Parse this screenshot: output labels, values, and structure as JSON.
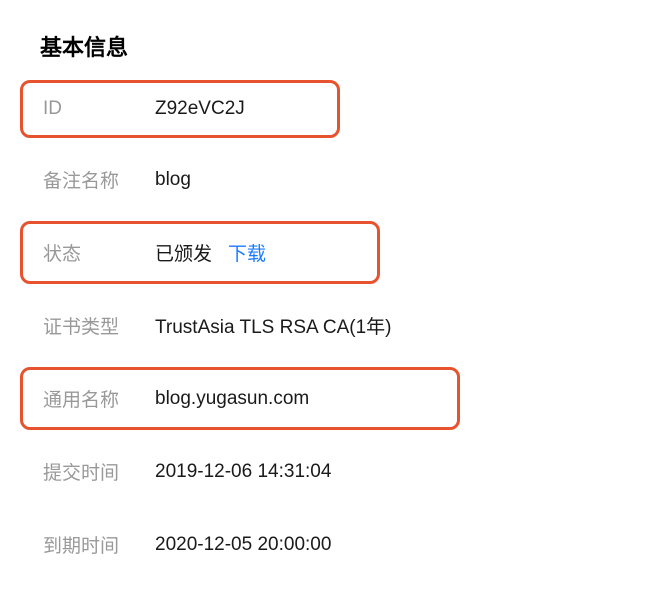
{
  "section_title": "基本信息",
  "rows": {
    "id": {
      "label": "ID",
      "value": "Z92eVC2J"
    },
    "remark_name": {
      "label": "备注名称",
      "value": "blog"
    },
    "status": {
      "label": "状态",
      "value": "已颁发",
      "link": "下载"
    },
    "cert_type": {
      "label": "证书类型",
      "value": "TrustAsia TLS RSA CA(1年)"
    },
    "common_name": {
      "label": "通用名称",
      "value": "blog.yugasun.com"
    },
    "submit_time": {
      "label": "提交时间",
      "value": "2019-12-06 14:31:04"
    },
    "expire_time": {
      "label": "到期时间",
      "value": "2020-12-05 20:00:00"
    }
  }
}
